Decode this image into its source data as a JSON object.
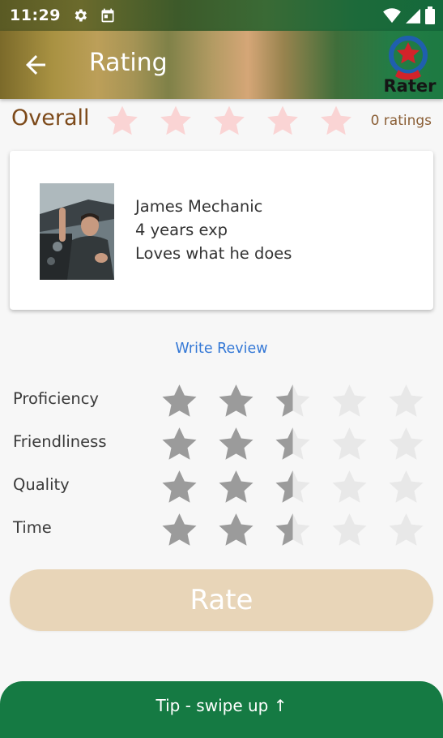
{
  "status_bar": {
    "time": "11:29",
    "icons": [
      "settings-icon",
      "calendar-icon",
      "wifi-icon",
      "signal-icon",
      "battery-icon"
    ]
  },
  "app_bar": {
    "title": "Rating",
    "back_icon": "arrow-back-icon",
    "logo_text": "Rater"
  },
  "overall": {
    "label": "Overall",
    "rating": 0,
    "max": 5,
    "count_text": "0 ratings"
  },
  "profile": {
    "name": "James Mechanic",
    "experience": "4 years exp",
    "tagline": "Loves what he does"
  },
  "write_review_label": "Write Review",
  "criteria": [
    {
      "label": "Proficiency",
      "rating": 2.5,
      "max": 5
    },
    {
      "label": "Friendliness",
      "rating": 2.5,
      "max": 5
    },
    {
      "label": "Quality",
      "rating": 2.5,
      "max": 5
    },
    {
      "label": "Time",
      "rating": 2.5,
      "max": 5
    }
  ],
  "rate_button_label": "Rate",
  "tip_text": "Tip - swipe up ↑",
  "colors": {
    "overall_star": "#fad4d4",
    "filled_star": "#9b9b9b",
    "empty_star": "#e8e8e8",
    "rate_button": "#e8d5b8",
    "tip_bar": "#157a43",
    "link": "#3478d6",
    "overall_label": "#7d4a1a"
  }
}
